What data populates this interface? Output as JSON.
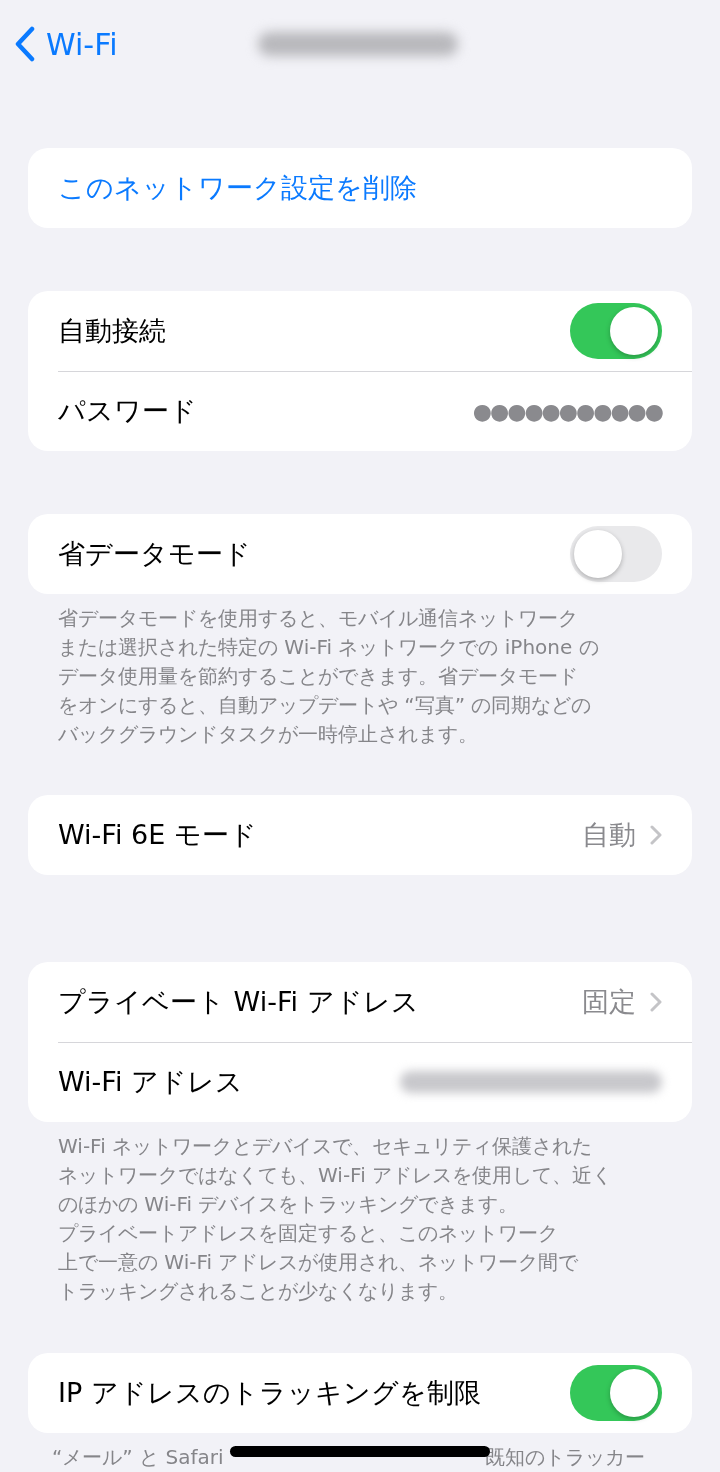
{
  "nav": {
    "back_label": "Wi-Fi"
  },
  "groups": [
    {
      "rows": [
        {
          "kind": "action",
          "label": "このネットワーク設定を削除"
        }
      ]
    },
    {
      "rows": [
        {
          "kind": "toggle",
          "label": "自動接続",
          "on": true
        },
        {
          "kind": "value",
          "label": "パスワード",
          "value": "●●●●●●●●●●●"
        }
      ]
    },
    {
      "rows": [
        {
          "kind": "toggle",
          "label": "省データモード",
          "on": false
        }
      ],
      "footer_lines": [
        "省データモードを使用すると、モバイル通信ネットワーク",
        "または選択された特定の Wi-Fi ネットワークでの iPhone の",
        "データ使用量を節約することができます。省データモード",
        "をオンにすると、自動アップデートや “写真” の同期などの",
        "バックグラウンドタスクが一時停止されます。"
      ]
    },
    {
      "rows": [
        {
          "kind": "link",
          "label": "Wi-Fi 6E モード",
          "value": "自動"
        }
      ]
    },
    {
      "rows": [
        {
          "kind": "link",
          "label": "プライベート Wi-Fi アドレス",
          "value": "固定"
        },
        {
          "kind": "blurred",
          "label": "Wi-Fi アドレス"
        }
      ],
      "footer_lines": [
        "Wi-Fi ネットワークとデバイスで、セキュリティ保護された",
        "ネットワークではなくても、Wi-Fi アドレスを使用して、近く",
        "のほかの Wi-Fi デバイスをトラッキングできます。",
        "プライベートアドレスを固定すると、このネットワーク",
        "上で一意の Wi-Fi アドレスが使用され、ネットワーク間で",
        "トラッキングされることが少なくなります。"
      ]
    },
    {
      "rows": [
        {
          "kind": "toggle",
          "label": "IP アドレスのトラッキングを制限",
          "on": true
        }
      ],
      "footer_parts": [
        "“メール” と Safari",
        "既知のトラッカー"
      ]
    }
  ]
}
